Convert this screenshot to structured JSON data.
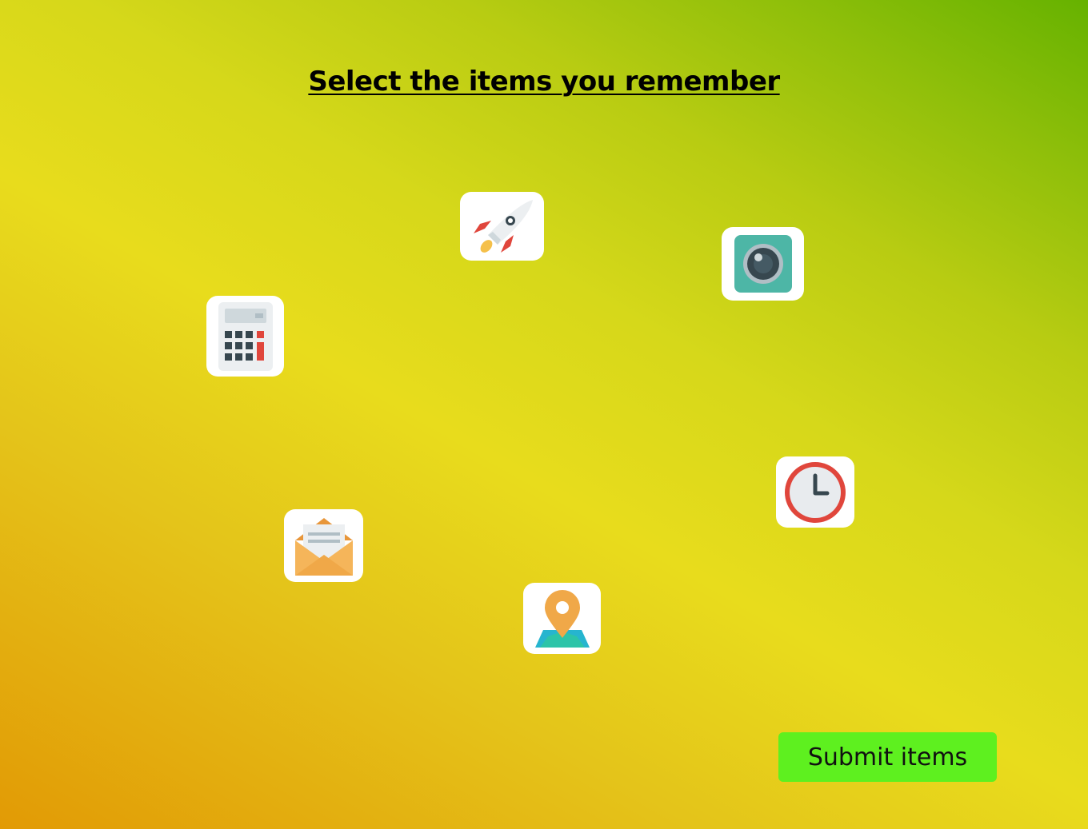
{
  "heading": "Select the items you remember",
  "items": [
    {
      "icon": "rocket-icon"
    },
    {
      "icon": "camera-icon"
    },
    {
      "icon": "calculator-icon"
    },
    {
      "icon": "clock-icon"
    },
    {
      "icon": "mail-icon"
    },
    {
      "icon": "map-pin-icon"
    }
  ],
  "submit_label": "Submit items",
  "colors": {
    "submit_button": "#5ef01f",
    "tile_background": "#ffffff",
    "background_gradient": [
      "#e29a05",
      "#e8dc1c",
      "#66b200"
    ]
  }
}
